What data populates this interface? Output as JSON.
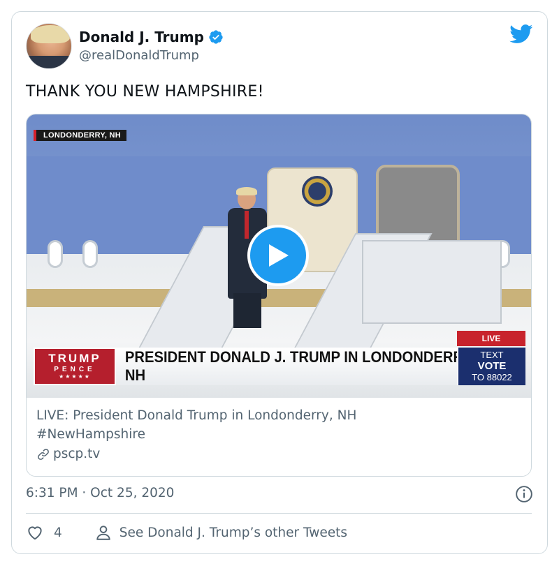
{
  "author": {
    "display_name": "Donald J. Trump",
    "handle": "@realDonaldTrump",
    "verified": true
  },
  "tweet": {
    "text": "THANK YOU NEW HAMPSHIRE!",
    "timestamp": "6:31 PM · Oct 25, 2020",
    "like_count": "4"
  },
  "media": {
    "location_tag": "LONDONDERRY, NH",
    "brand_line1": "TRUMP",
    "brand_line2": "PENCE",
    "brand_stars": "★★★★★",
    "headline": "PRESIDENT DONALD J. TRUMP IN LONDONDERRY, NH",
    "live_label": "LIVE",
    "text_vote_line1": "TEXT",
    "text_vote_line2": "VOTE",
    "text_vote_line3": "TO 88022"
  },
  "link_card": {
    "title_line1": "LIVE: President Donald Trump in Londonderry, NH",
    "title_line2": "#NewHampshire",
    "domain": "pscp.tv"
  },
  "footer": {
    "profile_link": "See Donald J. Trump’s other Tweets"
  },
  "colors": {
    "twitter_blue": "#1d9bf0",
    "secondary_text": "#536471",
    "border": "#cfd9de",
    "live_red": "#c8232c"
  },
  "icons": [
    "verified-badge-icon",
    "twitter-bird-icon",
    "play-icon",
    "link-icon",
    "info-icon",
    "heart-icon",
    "person-icon"
  ]
}
